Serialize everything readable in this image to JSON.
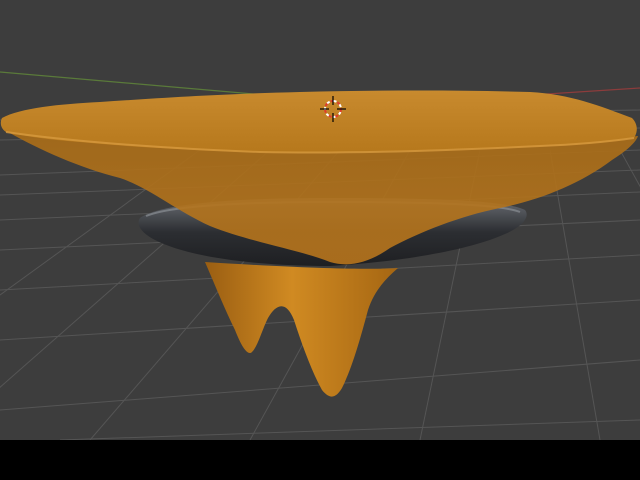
{
  "viewport": {
    "mode": "3d-viewport",
    "background_color": "#3d3d3d",
    "grid_color": "#555555",
    "x_axis_color": "#8c3c3c",
    "y_axis_color": "#5a7a3a"
  },
  "object": {
    "name": "",
    "material_color": "#c07a1a",
    "ring_color": "#3c3f44"
  },
  "cursor_3d": {
    "icon": "3d-cursor-icon",
    "ring_colors": [
      "#e03c2c",
      "#ffffff"
    ]
  },
  "bottom_bar": {
    "color": "#000000"
  }
}
